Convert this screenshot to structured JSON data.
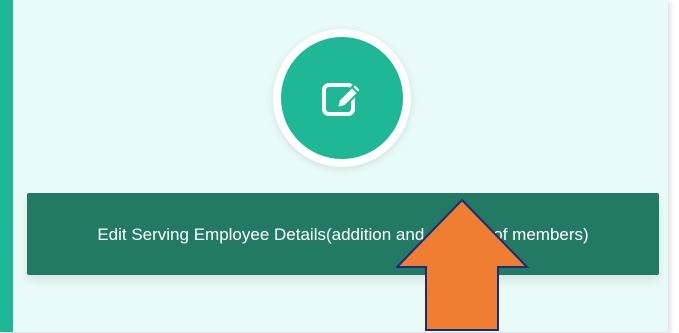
{
  "card": {
    "accent_color": "#1fb896",
    "background_color": "#e8fbf6",
    "icon": "edit-icon",
    "button": {
      "label": "Edit Serving Employee Details(addition and deletion of members)",
      "background_color": "#227a64"
    }
  },
  "annotation": {
    "icon": "up-arrow-icon",
    "color": "#ef7d32"
  }
}
